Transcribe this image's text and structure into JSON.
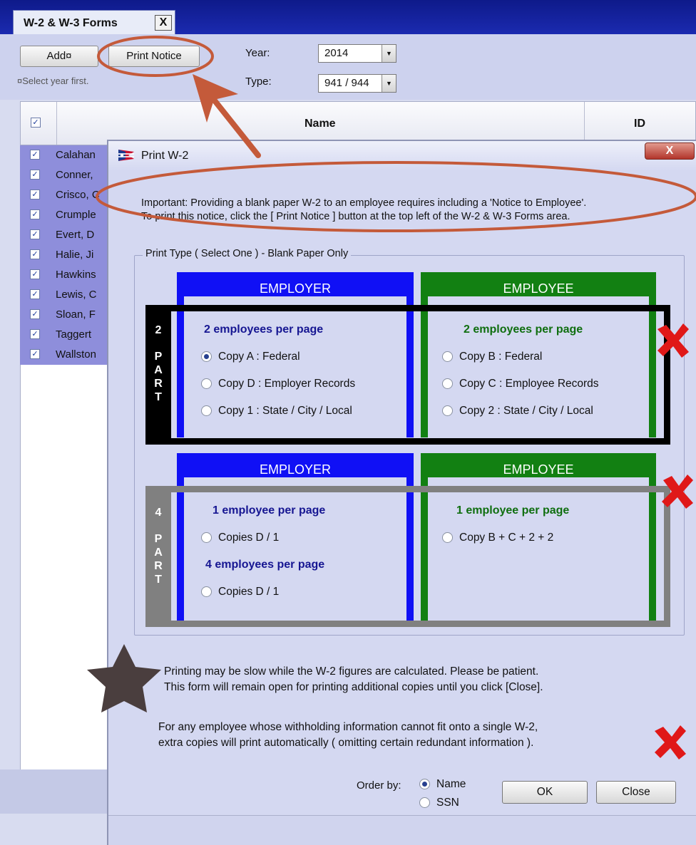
{
  "window": {
    "tab_title": "W-2 & W-3 Forms",
    "tab_close": "X"
  },
  "toolbar": {
    "add_label": "Add¤",
    "print_notice_label": "Print Notice",
    "hint": "¤Select year first.",
    "year_label": "Year:",
    "year_value": "2014",
    "type_label": "Type:",
    "type_value": "941 / 944"
  },
  "grid": {
    "columns": [
      "Name",
      "ID"
    ],
    "header_checked": true,
    "rows": [
      {
        "name": "Calahan",
        "checked": true
      },
      {
        "name": "Conner,",
        "checked": true
      },
      {
        "name": "Crisco, C",
        "checked": true
      },
      {
        "name": "Crumple",
        "checked": true
      },
      {
        "name": "Evert, D",
        "checked": true
      },
      {
        "name": "Halie, Ji",
        "checked": true
      },
      {
        "name": "Hawkins",
        "checked": true
      },
      {
        "name": "Lewis, C",
        "checked": true
      },
      {
        "name": "Sloan, F",
        "checked": true
      },
      {
        "name": "Taggert",
        "checked": true
      },
      {
        "name": "Wallston",
        "checked": true
      }
    ]
  },
  "dialog": {
    "title": "Print W-2",
    "close_label": "X",
    "important_line1": "Important: Providing a blank paper W-2 to an employee requires including a 'Notice to Employee'.",
    "important_line2": "To print this notice, click the  [ Print Notice ]  button at the top left of the W-2 & W-3 Forms area.",
    "group_legend": "Print Type ( Select One ) - Blank Paper Only",
    "two_part": {
      "strip": [
        "2",
        "",
        "P",
        "A",
        "R",
        "T"
      ],
      "employer": {
        "header": "EMPLOYER",
        "subhead": "2 employees per page",
        "options": [
          {
            "label": "Copy A  :  Federal",
            "selected": true
          },
          {
            "label": "Copy D  :  Employer Records",
            "selected": false
          },
          {
            "label": "Copy 1   :  State / City / Local",
            "selected": false
          }
        ]
      },
      "employee": {
        "header": "EMPLOYEE",
        "subhead": "2 employees per page",
        "options": [
          {
            "label": "Copy B  :  Federal",
            "selected": false
          },
          {
            "label": "Copy C  :  Employee Records",
            "selected": false
          },
          {
            "label": "Copy 2  :  State / City / Local",
            "selected": false
          }
        ]
      }
    },
    "four_part": {
      "strip": [
        "4",
        "",
        "P",
        "A",
        "R",
        "T"
      ],
      "employer": {
        "header": "EMPLOYER",
        "subhead1": "1 employee per page",
        "option1": "Copies D / 1",
        "subhead2": "4 employees per page",
        "option2": "Copies D / 1"
      },
      "employee": {
        "header": "EMPLOYEE",
        "subhead": "1 employee per page",
        "option": "Copy B + C + 2 + 2"
      }
    },
    "note1_line1": "Printing may be slow while the W-2 figures are calculated.  Please be patient.",
    "note1_line2": "This form will remain open for printing additional copies until you click [Close].",
    "note2_line1": "For any employee whose withholding information cannot fit onto a single W-2,",
    "note2_line2": "extra copies will print automatically  ( omitting certain redundant information ).",
    "order_by_label": "Order by:",
    "order_options": [
      {
        "label": "Name",
        "selected": true
      },
      {
        "label": "SSN",
        "selected": false
      }
    ],
    "ok_label": "OK",
    "close_button_label": "Close"
  },
  "colors": {
    "employer_blue": "#1010f5",
    "employee_green": "#128012",
    "employer_text": "#161692",
    "employee_text": "#0f6e0f",
    "annotation_red": "#c45a3a",
    "x_red": "#e01818"
  }
}
